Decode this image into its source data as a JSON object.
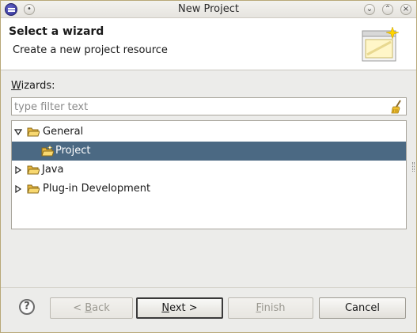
{
  "window": {
    "title": "New Project"
  },
  "banner": {
    "title": "Select a wizard",
    "description": "Create a new project resource"
  },
  "wizards": {
    "label_prefix": "W",
    "label_rest": "izards:",
    "filter_placeholder": "type filter text",
    "filter_value": ""
  },
  "tree": {
    "items": [
      {
        "label": "General",
        "expanded": true,
        "icon": "folder-open-icon"
      },
      {
        "label": "Project",
        "selected": true,
        "icon": "project-wizard-icon"
      },
      {
        "label": "Java",
        "expanded": false,
        "icon": "folder-icon"
      },
      {
        "label": "Plug-in Development",
        "expanded": false,
        "icon": "folder-icon"
      }
    ]
  },
  "buttons": {
    "help": "?",
    "back_prefix": "< ",
    "back_mnemonic": "B",
    "back_rest": "ack",
    "next_mnemonic": "N",
    "next_rest": "ext >",
    "finish_mnemonic": "F",
    "finish_rest": "inish",
    "cancel": "Cancel"
  },
  "colors": {
    "selection": "#4b6983",
    "window_bg": "#ececea"
  }
}
